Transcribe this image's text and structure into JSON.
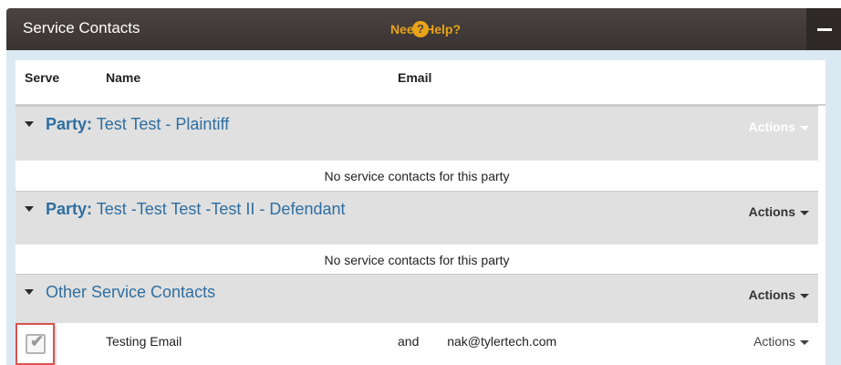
{
  "panel": {
    "title": "Service Contacts",
    "help_label": "Need Help?",
    "help_icon": "?"
  },
  "table": {
    "columns": {
      "serve": "Serve",
      "name": "Name",
      "email": "Email"
    },
    "groups": [
      {
        "prefix": "Party:",
        "name": "Test Test - Plaintiff",
        "actions": "Actions",
        "empty_message": "No service contacts for this party"
      },
      {
        "prefix": "Party:",
        "name": "Test -Test Test -Test II - Defendant",
        "actions": "Actions",
        "empty_message": "No service contacts for this party"
      },
      {
        "prefix": "",
        "name": "Other Service Contacts",
        "actions": "Actions"
      }
    ],
    "contacts": [
      {
        "name": "Testing Email",
        "email": "and           nak@tylertech.com",
        "actions": "Actions",
        "checked": true
      }
    ]
  },
  "colors": {
    "header_bg": "#4a4341",
    "help": "#e8a317",
    "group_label": "#2f6ea0",
    "highlight": "#d9534f"
  },
  "icons": {
    "collapse": "minus-icon",
    "expand_group": "caret-down-icon",
    "checkbox": "checkbox-checked-icon"
  }
}
